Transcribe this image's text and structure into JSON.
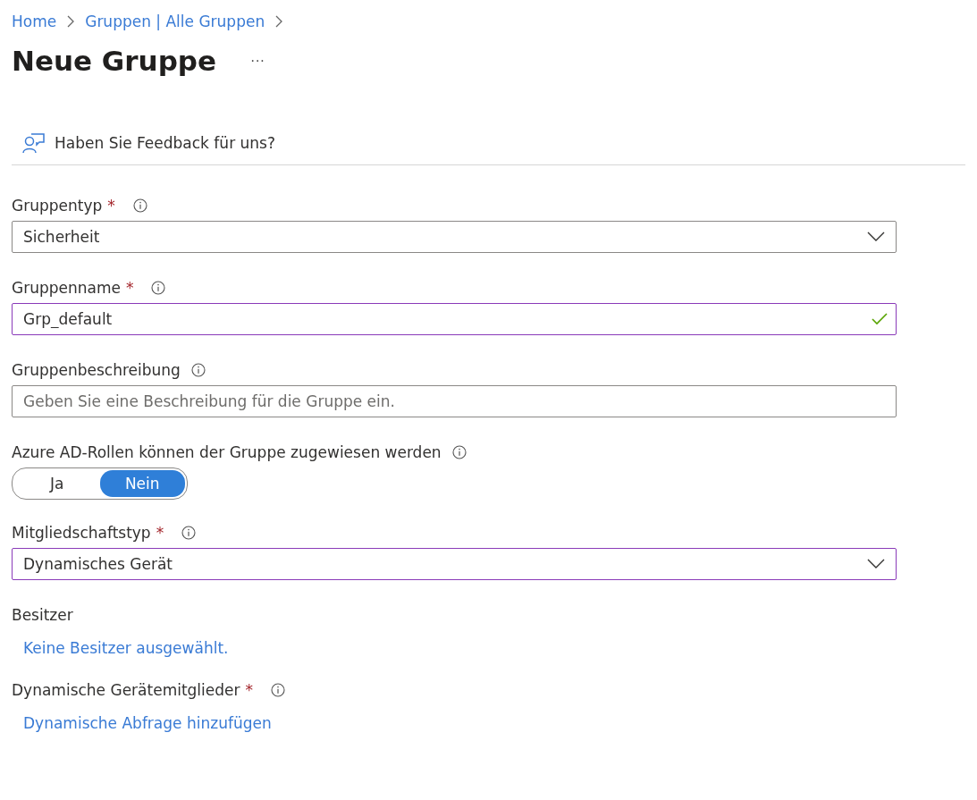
{
  "breadcrumb": [
    {
      "label": "Home"
    },
    {
      "label": "Gruppen | Alle Gruppen"
    }
  ],
  "title": "Neue Gruppe",
  "more_menu": "···",
  "feedback": "Haben Sie Feedback für uns?",
  "fields": [
    {
      "kind": "select",
      "label": "Gruppentyp",
      "required_mark": "*",
      "value": "Sicherheit",
      "highlighted": false,
      "info": true
    },
    {
      "kind": "text",
      "label": "Gruppenname",
      "required_mark": "*",
      "value": "Grp_default",
      "highlighted": true,
      "valid": true,
      "info": true
    },
    {
      "kind": "text",
      "label": "Gruppenbeschreibung",
      "placeholder": "Geben Sie eine Beschreibung für die Gruppe ein.",
      "highlighted": false,
      "info": true
    },
    {
      "kind": "toggle",
      "label": "Azure AD-Rollen können der Gruppe zugewiesen werden",
      "info": true,
      "options": [
        {
          "label": "Ja",
          "selected": false
        },
        {
          "label": "Nein",
          "selected": true
        }
      ]
    },
    {
      "kind": "select",
      "label": "Mitgliedschaftstyp",
      "required_mark": "*",
      "value": "Dynamisches Gerät",
      "highlighted": true,
      "info": true
    },
    {
      "kind": "link",
      "label": "Besitzer",
      "link": "Keine Besitzer ausgewählt.",
      "info": false
    },
    {
      "kind": "link",
      "label": "Dynamische Gerätemitglieder",
      "required_mark": "*",
      "link": "Dynamische Abfrage hinzufügen",
      "info": true
    }
  ]
}
